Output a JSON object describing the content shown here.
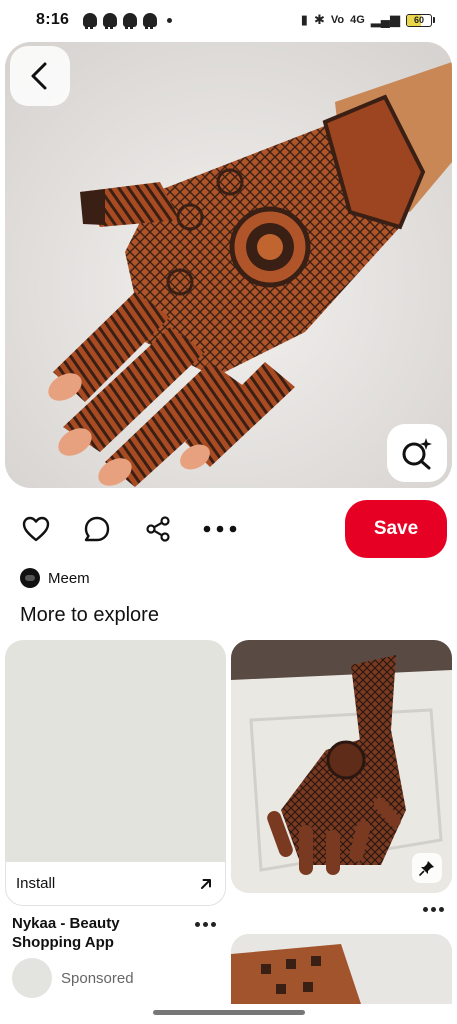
{
  "status_bar": {
    "time": "8:16",
    "battery_level": "60",
    "network_label": "4G",
    "notification_icons": [
      "snapchat-icon",
      "snapchat-icon",
      "snapchat-icon",
      "snapchat-icon"
    ]
  },
  "pin": {
    "save_label": "Save",
    "actions": [
      "heart-icon",
      "comment-icon",
      "share-icon",
      "more-icon"
    ],
    "creator_name": "Meem"
  },
  "more_to_explore": {
    "title": "More to explore",
    "ad": {
      "cta_label": "Install",
      "title": "Nykaa - Beauty Shopping App",
      "sponsored_label": "Sponsored"
    }
  },
  "colors": {
    "save_button": "#e60023",
    "henna": "#a24a22",
    "henna_dark": "#3a1f14"
  }
}
